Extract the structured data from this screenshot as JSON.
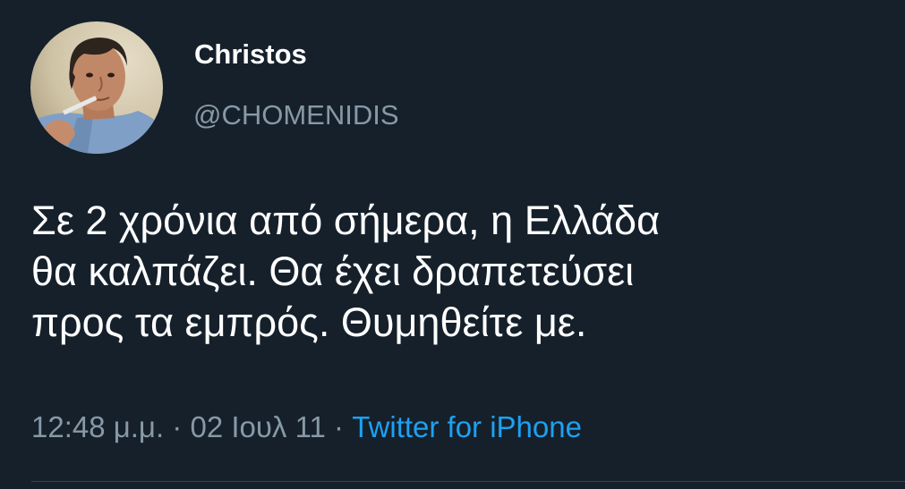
{
  "author": {
    "name": "Christos",
    "handle": "@CHOMENIDIS"
  },
  "tweet": {
    "text": "Σε 2 χρόνια από σήμερα, η Ελλάδα\nθα καλπάζει. Θα έχει δραπετεύσει\nπρος τα εμπρός. Θυμηθείτε με."
  },
  "meta": {
    "time": "12:48 μ.μ.",
    "separator": "·",
    "date": "02 Ιουλ 11",
    "source": "Twitter for iPhone"
  },
  "colors": {
    "background": "#15202b",
    "secondary_text": "#8899a6",
    "link": "#1da1f2"
  }
}
